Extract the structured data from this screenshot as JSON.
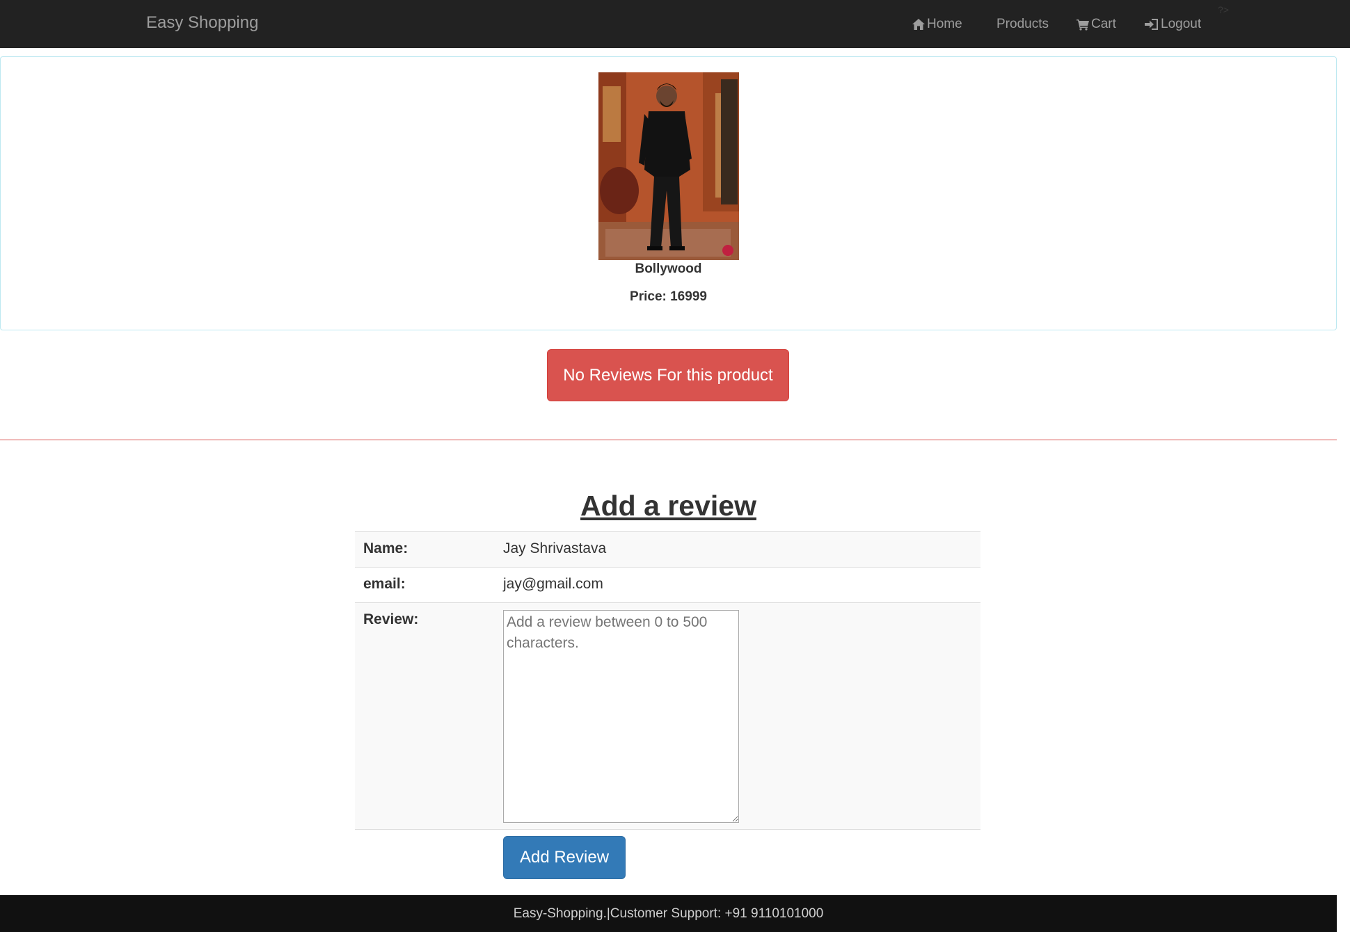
{
  "navbar": {
    "brand": "Easy Shopping",
    "home": "Home",
    "products": "Products",
    "cart": "Cart",
    "logout": "Logout",
    "stray_text": "?>"
  },
  "product": {
    "name": "Bollywood",
    "price": "Price: 16999"
  },
  "reviews": {
    "empty_message": "No Reviews For this product"
  },
  "review_form": {
    "title": "Add a review",
    "name_label": "Name:",
    "name_value": "Jay Shrivastava",
    "email_label": "email:",
    "email_value": "jay@gmail.com",
    "review_label": "Review:",
    "review_placeholder": "Add a review between 0 to 500 characters.",
    "submit_label": "Add Review"
  },
  "footer": {
    "text": "Easy-Shopping.|Customer Support: +91 9110101000"
  },
  "colors": {
    "navbar_bg": "#222222",
    "danger": "#d9534f",
    "primary": "#337ab7",
    "footer_bg": "#111111"
  },
  "icons": {
    "home": "home-icon",
    "cart": "cart-icon",
    "logout": "logout-icon"
  }
}
